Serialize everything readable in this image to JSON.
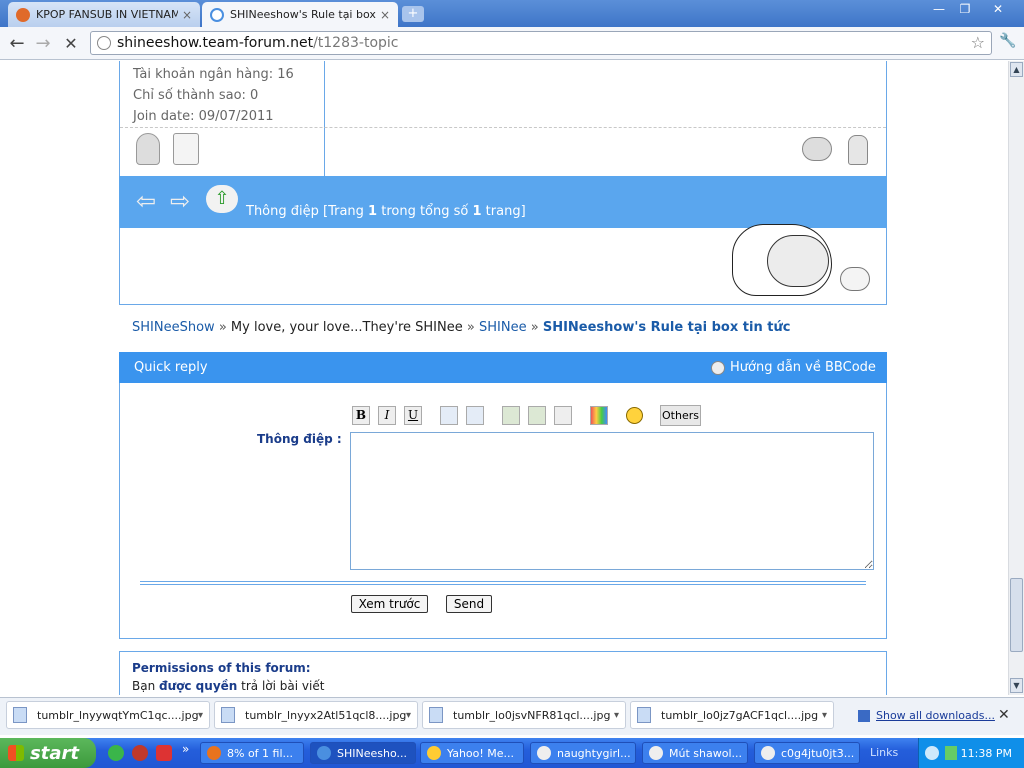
{
  "browser": {
    "tabs": [
      {
        "label": "KPOP FANSUB IN VIETNAM",
        "close": "×"
      },
      {
        "label": "SHINeeshow's Rule tại box tin",
        "close": "×"
      }
    ],
    "new_tab": "+",
    "window_controls": {
      "minimize": "—",
      "maximize": "❐",
      "close": "✕"
    },
    "nav": {
      "back": "←",
      "forward": "→",
      "stop": "✕"
    },
    "address": {
      "host": "shineeshow.team-forum.net",
      "path": "/t1283-topic"
    },
    "star": "☆",
    "wrench": "🔧"
  },
  "profile": {
    "bank": "Tài khoản ngân hàng: 16",
    "star_index": "Chỉ số thành sao: 0",
    "join_date": "Join date: 09/07/2011"
  },
  "pager": {
    "prefix": "Thông điệp [Trang ",
    "current": "1",
    "middle": " trong tổng số ",
    "total": "1",
    "suffix": " trang]"
  },
  "breadcrumb": {
    "items": [
      "SHINeeShow",
      "My love, your love...They're SHINee",
      "SHINee",
      "SHINeeshow's Rule tại box tin tức"
    ],
    "separator": "»"
  },
  "quick_reply": {
    "title": "Quick reply",
    "bbcode_help": "Hướng dẫn về BBCode",
    "editor_buttons": {
      "bold": "B",
      "italic": "I",
      "underline": "U",
      "others": "Others"
    },
    "message_label": "Thông điệp :",
    "preview_button": "Xem trước",
    "send_button": "Send"
  },
  "permissions": {
    "title": "Permissions of this forum:",
    "line_prefix": "Bạn ",
    "line_bold": "được quyền",
    "line_suffix": " trả lời bài viết"
  },
  "downloads": {
    "items": [
      {
        "name": "tumblr_lnyywqtYmC1qc....jpg"
      },
      {
        "name": "tumblr_lnyyx2Atl51qcl8....jpg"
      },
      {
        "name": "tumblr_lo0jsvNFR81qcl....jpg"
      },
      {
        "name": "tumblr_lo0jz7gACF1qcl....jpg"
      }
    ],
    "show_all": "Show all downloads...",
    "close": "✕"
  },
  "taskbar": {
    "start": "start",
    "tasks": [
      {
        "label": "8% of 1 fil..."
      },
      {
        "label": "SHINeesho..."
      },
      {
        "label": "Yahoo! Me..."
      },
      {
        "label": "naughtygirl..."
      },
      {
        "label": "Mút shawol..."
      },
      {
        "label": "c0g4jtu0jt3..."
      }
    ],
    "links": "Links",
    "clock": "11:38 PM"
  }
}
